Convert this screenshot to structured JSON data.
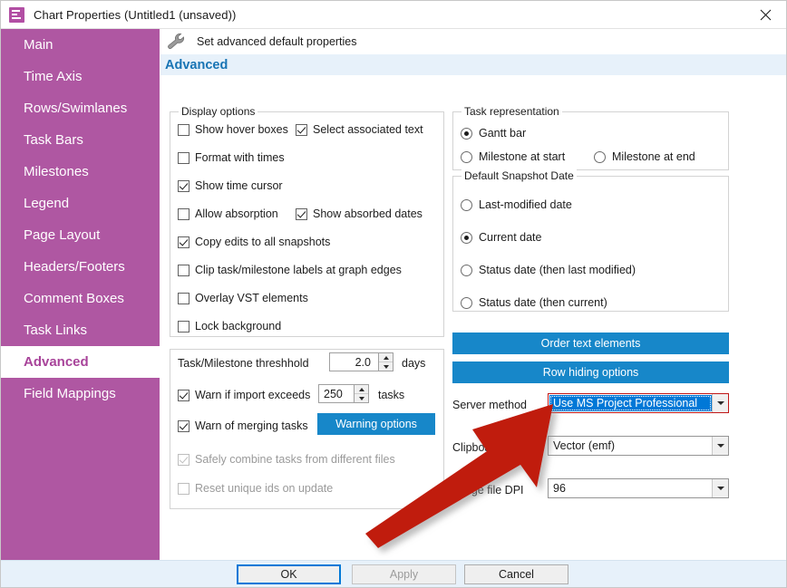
{
  "window": {
    "title": "Chart Properties (Untitled1 (unsaved))",
    "app_icon": "gantt-chart-icon",
    "close_label": "✕"
  },
  "sidebar": {
    "items": [
      {
        "label": "Main",
        "active": false
      },
      {
        "label": "Time Axis",
        "active": false
      },
      {
        "label": "Rows/Swimlanes",
        "active": false
      },
      {
        "label": "Task Bars",
        "active": false
      },
      {
        "label": "Milestones",
        "active": false
      },
      {
        "label": "Legend",
        "active": false
      },
      {
        "label": "Page Layout",
        "active": false
      },
      {
        "label": "Headers/Footers",
        "active": false
      },
      {
        "label": "Comment Boxes",
        "active": false
      },
      {
        "label": "Task Links",
        "active": false
      },
      {
        "label": "Advanced",
        "active": true
      },
      {
        "label": "Field Mappings",
        "active": false
      }
    ]
  },
  "header": {
    "hint": "Set advanced default properties",
    "hint_icon": "wrench-icon",
    "section": "Advanced"
  },
  "display_options": {
    "legend": "Display options",
    "items": [
      {
        "label": "Show hover boxes",
        "checked": false,
        "disabled": false
      },
      {
        "label": "Select associated text",
        "checked": true,
        "disabled": false
      },
      {
        "label": "Format with times",
        "checked": false,
        "disabled": false
      },
      {
        "label": "Show time cursor",
        "checked": true,
        "disabled": false
      },
      {
        "label": "Allow absorption",
        "checked": false,
        "disabled": false
      },
      {
        "label": "Show absorbed dates",
        "checked": true,
        "disabled": false
      },
      {
        "label": "Copy edits to all snapshots",
        "checked": true,
        "disabled": false
      },
      {
        "label": "Clip task/milestone labels at graph edges",
        "checked": false,
        "disabled": false
      },
      {
        "label": "Overlay VST elements",
        "checked": false,
        "disabled": false
      },
      {
        "label": "Lock background",
        "checked": false,
        "disabled": false
      }
    ]
  },
  "threshold_panel": {
    "threshold_label": "Task/Milestone threshhold",
    "threshold_value": "2.0",
    "threshold_unit": "days",
    "warn_import_label": "Warn if import exceeds",
    "warn_import_checked": true,
    "warn_import_value": "250",
    "warn_import_unit": "tasks",
    "warn_merging_label": "Warn of merging tasks",
    "warn_merging_checked": true,
    "warning_options_button": "Warning options",
    "safely_combine_label": "Safely combine tasks from different files",
    "safely_combine_checked": true,
    "safely_combine_disabled": true,
    "reset_ids_label": "Reset unique ids on update",
    "reset_ids_checked": false,
    "reset_ids_disabled": true
  },
  "task_representation": {
    "legend": "Task representation",
    "options": [
      {
        "label": "Gantt bar",
        "selected": true
      },
      {
        "label": "Milestone at start",
        "selected": false
      },
      {
        "label": "Milestone at end",
        "selected": false
      }
    ]
  },
  "snapshot_date": {
    "legend": "Default Snapshot Date",
    "options": [
      {
        "label": "Last-modified date",
        "selected": false
      },
      {
        "label": "Current date",
        "selected": true
      },
      {
        "label": "Status date (then last modified)",
        "selected": false
      },
      {
        "label": "Status date (then current)",
        "selected": false
      }
    ]
  },
  "actions": {
    "order_text_elements": "Order text elements",
    "row_hiding_options": "Row hiding options"
  },
  "settings": {
    "server_method_label": "Server method",
    "server_method_value": "Use MS Project Professional",
    "clipboard_format_label": "Clipboard format",
    "clipboard_format_value": "Vector (emf)",
    "image_dpi_label": "Image file DPI",
    "image_dpi_value": "96"
  },
  "footer": {
    "ok": "OK",
    "apply": "Apply",
    "cancel": "Cancel"
  },
  "annotation": {
    "type": "red-arrow",
    "points_to": "server-method-combobox",
    "color": "#C01A10"
  }
}
